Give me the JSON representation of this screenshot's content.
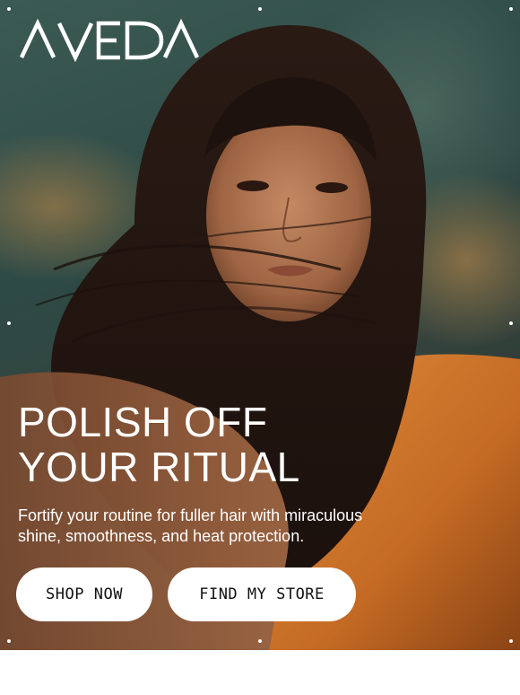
{
  "brand": {
    "logo_text": "AVEDA"
  },
  "hero": {
    "headline_line1": "POLISH OFF",
    "headline_line2": "YOUR RITUAL",
    "subtext_line1": "Fortify your routine for fuller hair with miraculous",
    "subtext_line2": "shine, smoothness, and heat protection."
  },
  "buttons": {
    "shop_label": "SHOP NOW",
    "store_label": "FIND MY STORE"
  },
  "colors": {
    "background_teal": "#2e4a46",
    "accent_orange": "#c96a1e",
    "button_bg": "#ffffff",
    "text_on_image": "#ffffff"
  }
}
